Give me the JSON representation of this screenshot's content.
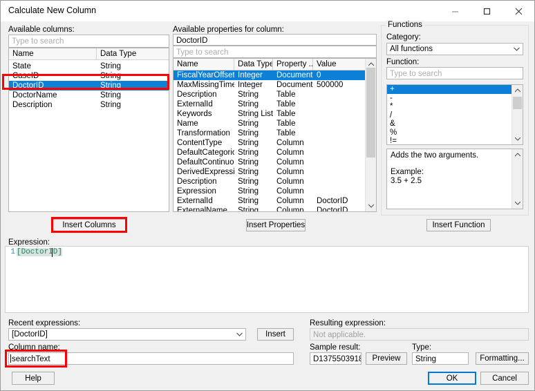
{
  "window": {
    "title": "Calculate New Column",
    "controls": [
      {
        "name": "minimize",
        "glyph": "─"
      },
      {
        "name": "maximize",
        "glyph": "□"
      },
      {
        "name": "close",
        "glyph": "✕"
      }
    ]
  },
  "available_columns": {
    "label": "Available columns:",
    "search_placeholder": "Type to search",
    "search_value": "",
    "headers": [
      "Name",
      "Data Type"
    ],
    "rows": [
      {
        "name": "State",
        "type": "String",
        "selected": false
      },
      {
        "name": "CaseID",
        "type": "String",
        "selected": false
      },
      {
        "name": "DoctorID",
        "type": "String",
        "selected": true
      },
      {
        "name": "DoctorName",
        "type": "String",
        "selected": false
      },
      {
        "name": "Description",
        "type": "String",
        "selected": false
      }
    ],
    "insert_button": "Insert Columns"
  },
  "available_properties": {
    "label": "Available properties for column:",
    "column_value": "DoctorID",
    "search_placeholder": "Type to search",
    "search_value": "",
    "headers": [
      "Name",
      "Data Type",
      "Property ...",
      "Value"
    ],
    "rows": [
      {
        "name": "FiscalYearOffset",
        "type": "Integer",
        "scope": "Document",
        "value": "0",
        "selected": true
      },
      {
        "name": "MaxMissingTime...",
        "type": "Integer",
        "scope": "Document",
        "value": "500000",
        "selected": false
      },
      {
        "name": "Description",
        "type": "String",
        "scope": "Table",
        "value": "",
        "selected": false
      },
      {
        "name": "ExternalId",
        "type": "String",
        "scope": "Table",
        "value": "",
        "selected": false
      },
      {
        "name": "Keywords",
        "type": "String List",
        "scope": "Table",
        "value": "",
        "selected": false
      },
      {
        "name": "Name",
        "type": "String",
        "scope": "Table",
        "value": "",
        "selected": false
      },
      {
        "name": "Transformation",
        "type": "String",
        "scope": "Table",
        "value": "",
        "selected": false
      },
      {
        "name": "ContentType",
        "type": "String",
        "scope": "Column",
        "value": "",
        "selected": false
      },
      {
        "name": "DefaultCategoric...",
        "type": "String",
        "scope": "Column",
        "value": "",
        "selected": false
      },
      {
        "name": "DefaultContinuo...",
        "type": "String",
        "scope": "Column",
        "value": "",
        "selected": false
      },
      {
        "name": "DerivedExpression",
        "type": "String",
        "scope": "Column",
        "value": "",
        "selected": false
      },
      {
        "name": "Description",
        "type": "String",
        "scope": "Column",
        "value": "",
        "selected": false
      },
      {
        "name": "Expression",
        "type": "String",
        "scope": "Column",
        "value": "",
        "selected": false
      },
      {
        "name": "ExternalId",
        "type": "String",
        "scope": "Column",
        "value": "DoctorID",
        "selected": false
      },
      {
        "name": "ExternalName",
        "type": "String",
        "scope": "Column",
        "value": "DoctorID",
        "selected": false
      }
    ],
    "insert_button": "Insert Properties"
  },
  "functions": {
    "group_label": "Functions",
    "category_label": "Category:",
    "category_value": "All functions",
    "function_label": "Function:",
    "search_placeholder": "Type to search",
    "search_value": "",
    "items": [
      {
        "label": "+",
        "selected": true
      },
      {
        "label": "-",
        "selected": false
      },
      {
        "label": "*",
        "selected": false
      },
      {
        "label": "/",
        "selected": false
      },
      {
        "label": "&",
        "selected": false
      },
      {
        "label": "%",
        "selected": false
      },
      {
        "label": "!=",
        "selected": false
      },
      {
        "label": "^",
        "selected": false
      }
    ],
    "description_line1": "Adds the two arguments.",
    "description_line2": "",
    "description_line3": "Example:",
    "description_line4": "3.5 + 2.5",
    "insert_button": "Insert Function"
  },
  "expression": {
    "label": "Expression:",
    "line_number": "1",
    "text": "[DoctorID]"
  },
  "recent": {
    "label": "Recent expressions:",
    "value": "[DoctorID]",
    "insert_button": "Insert"
  },
  "column_name": {
    "label": "Column name:",
    "value": "searchText"
  },
  "resulting": {
    "label": "Resulting expression:",
    "value": "Not applicable."
  },
  "sample": {
    "label": "Sample result:",
    "value": "D1375503918",
    "preview_button": "Preview"
  },
  "type": {
    "label": "Type:",
    "value": "String",
    "formatting_button": "Formatting..."
  },
  "footer": {
    "help_button": "Help",
    "ok_button": "OK",
    "cancel_button": "Cancel"
  },
  "highlights": {
    "accent_blue": "#0c7fd6",
    "annotation_red": "#ff0000"
  }
}
